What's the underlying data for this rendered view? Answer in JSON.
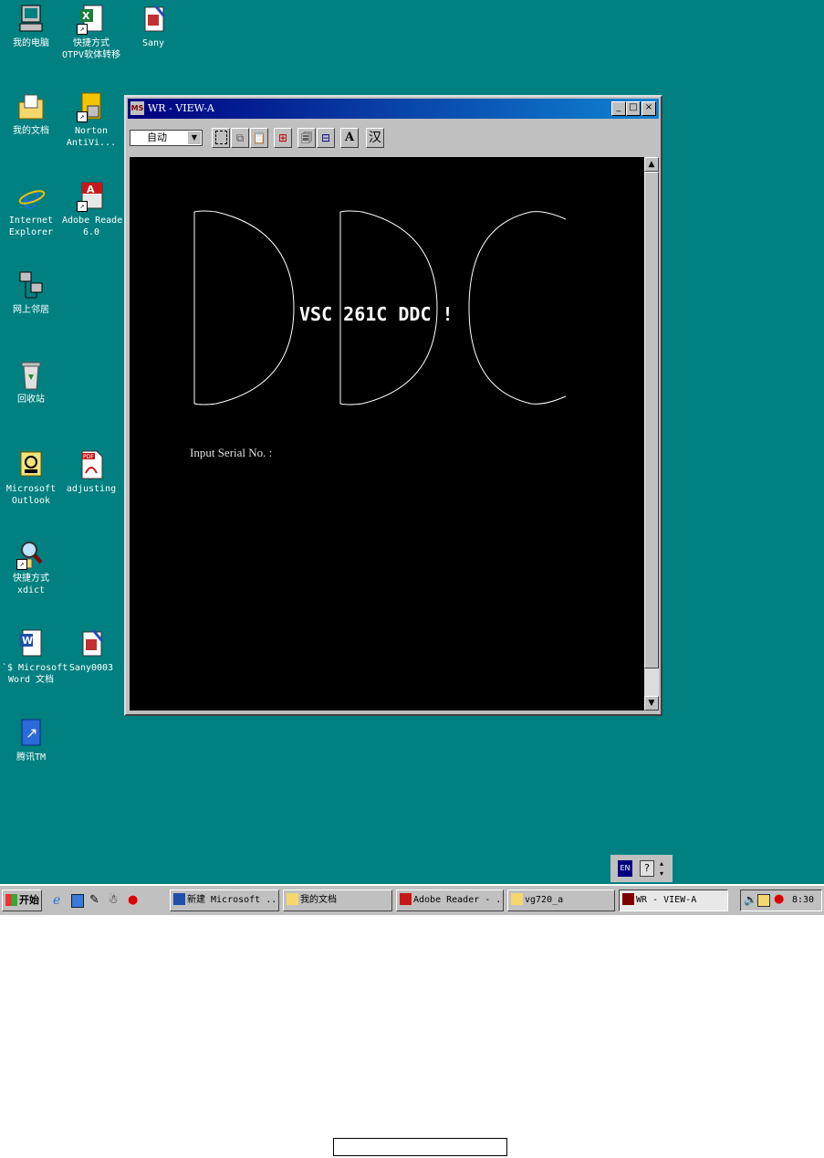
{
  "desktop": {
    "icons": [
      {
        "label_lines": [
          "我的电脑"
        ]
      },
      {
        "label_lines": [
          "快捷方式",
          "OTPV软体转移"
        ]
      },
      {
        "label_lines": [
          "Sany"
        ]
      },
      {
        "label_lines": [
          "我的文档"
        ]
      },
      {
        "label_lines": [
          "Norton",
          "AntiVi..."
        ]
      },
      {
        "label_lines": [
          "Internet",
          "Explorer"
        ]
      },
      {
        "label_lines": [
          "Adobe Reader",
          "6.0"
        ]
      },
      {
        "label_lines": [
          "网上邻居"
        ]
      },
      {
        "label_lines": [
          "回收站"
        ]
      },
      {
        "label_lines": [
          "Microsoft",
          "Outlook"
        ]
      },
      {
        "label_lines": [
          "adjusting"
        ]
      },
      {
        "label_lines": [
          "快捷方式",
          "xdict"
        ]
      },
      {
        "label_lines": [
          "`$ Microsoft",
          "Word 文档"
        ]
      },
      {
        "label_lines": [
          "Sany0003"
        ]
      },
      {
        "label_lines": [
          "腾讯TM"
        ]
      }
    ]
  },
  "window": {
    "title": "WR - VIEW-A",
    "app_icon_text": "MS",
    "font_select": "自动",
    "toolbar": {
      "font_button": "A",
      "han_button": "汉"
    },
    "screen": {
      "big_letters": "DDC",
      "banner": "VSC 261C DDC !",
      "prompt": "Input Serial No. :"
    }
  },
  "ime_bar": {
    "lang": "EN",
    "help": "?"
  },
  "taskbar": {
    "start_label": "开始",
    "buttons": [
      {
        "label": "新建 Microsoft ..."
      },
      {
        "label": "我的文档"
      },
      {
        "label": "Adobe Reader - ..."
      },
      {
        "label": "vg720_a"
      },
      {
        "label": "WR - VIEW-A"
      }
    ],
    "clock": "8:30"
  },
  "colors": {
    "desktop": "#008080",
    "title_bar": "#000080",
    "terminal_bg": "#000000"
  }
}
